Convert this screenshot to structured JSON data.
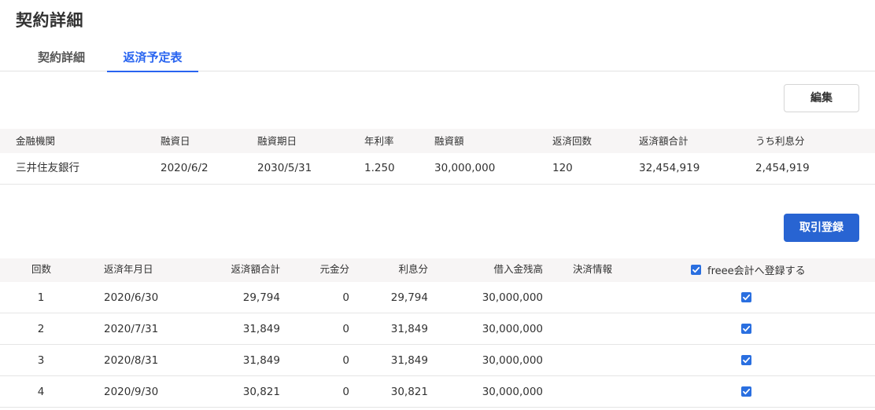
{
  "page": {
    "title": "契約詳細"
  },
  "tabs": [
    {
      "label": "契約詳細",
      "active": false
    },
    {
      "label": "返済予定表",
      "active": true
    }
  ],
  "buttons": {
    "edit": "編集",
    "register": "取引登録"
  },
  "contract": {
    "columns": [
      "金融機関",
      "融資日",
      "融資期日",
      "年利率",
      "融資額",
      "返済回数",
      "返済額合計",
      "うち利息分"
    ],
    "row": [
      "三井住友銀行",
      "2020/6/2",
      "2030/5/31",
      "1.250",
      "30,000,000",
      "120",
      "32,454,919",
      "2,454,919"
    ]
  },
  "schedule": {
    "columns": [
      "回数",
      "返済年月日",
      "返済額合計",
      "元金分",
      "利息分",
      "借入金残高",
      "決済情報"
    ],
    "register_label": "freee会計へ登録する",
    "register_all_checked": true,
    "rows": [
      {
        "no": "1",
        "date": "2020/6/30",
        "total": "29,794",
        "principal": "0",
        "interest": "29,794",
        "balance": "30,000,000",
        "settlement": "",
        "checked": true
      },
      {
        "no": "2",
        "date": "2020/7/31",
        "total": "31,849",
        "principal": "0",
        "interest": "31,849",
        "balance": "30,000,000",
        "settlement": "",
        "checked": true
      },
      {
        "no": "3",
        "date": "2020/8/31",
        "total": "31,849",
        "principal": "0",
        "interest": "31,849",
        "balance": "30,000,000",
        "settlement": "",
        "checked": true
      },
      {
        "no": "4",
        "date": "2020/9/30",
        "total": "30,821",
        "principal": "0",
        "interest": "30,821",
        "balance": "30,000,000",
        "settlement": "",
        "checked": true
      }
    ]
  },
  "colors": {
    "accent": "#2864f0",
    "primary_button": "#2864d2",
    "header_bg": "#f7f5f5",
    "checkbox": "#2a6fe0"
  }
}
